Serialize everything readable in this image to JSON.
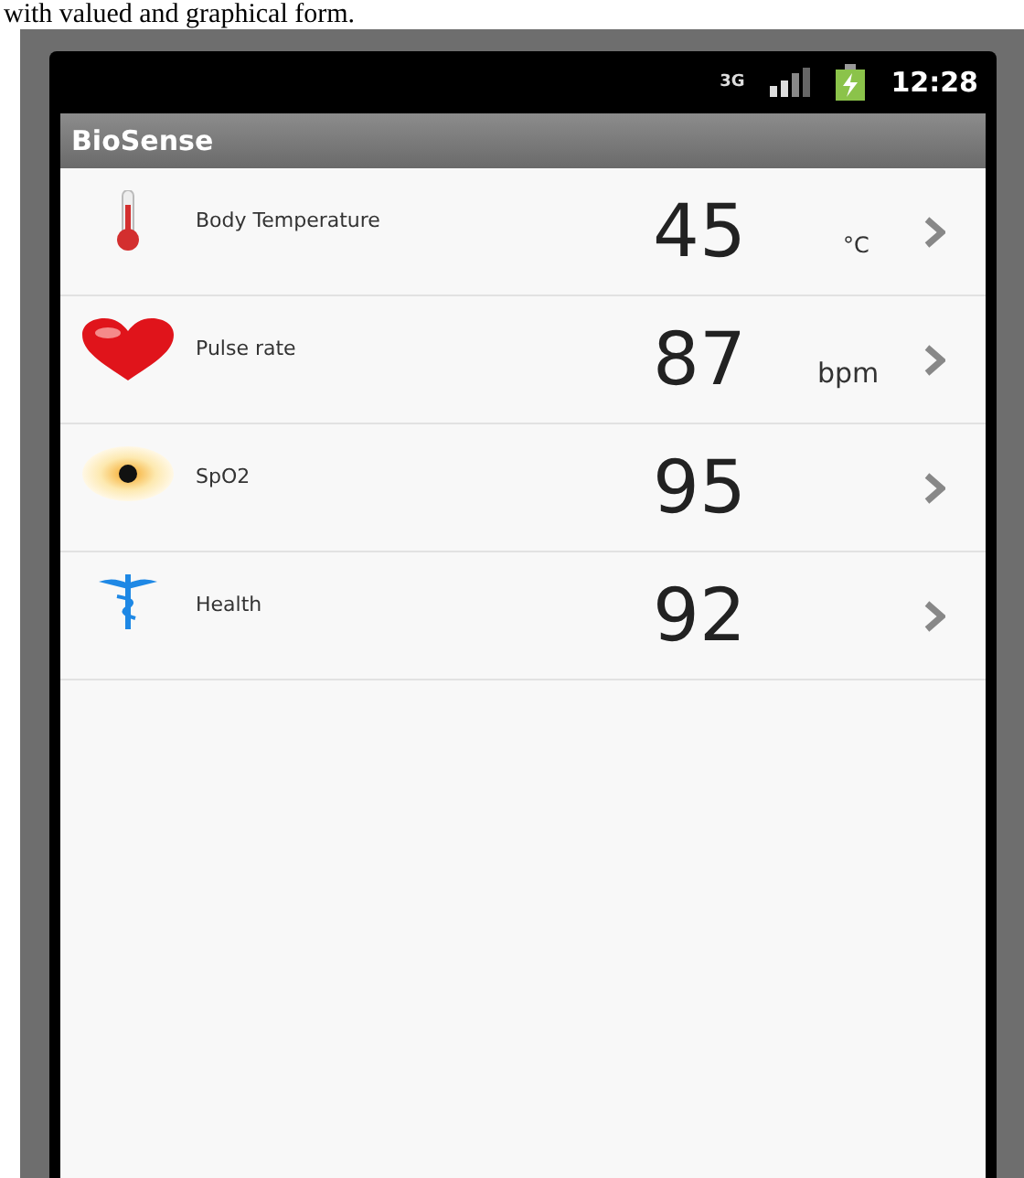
{
  "caption": "with valued and graphical form.",
  "status_bar": {
    "network": "3G",
    "time": "12:28"
  },
  "app_title": "BioSense",
  "readings": [
    {
      "kind": "thermometer",
      "label": "Body Temperature",
      "value": "45",
      "unit": "°C"
    },
    {
      "kind": "heart",
      "label": "Pulse rate",
      "value": "87",
      "unit": "bpm"
    },
    {
      "kind": "spot",
      "label": "SpO2",
      "value": "95"
    },
    {
      "kind": "caduceus",
      "label": "Health",
      "value": "92"
    }
  ]
}
